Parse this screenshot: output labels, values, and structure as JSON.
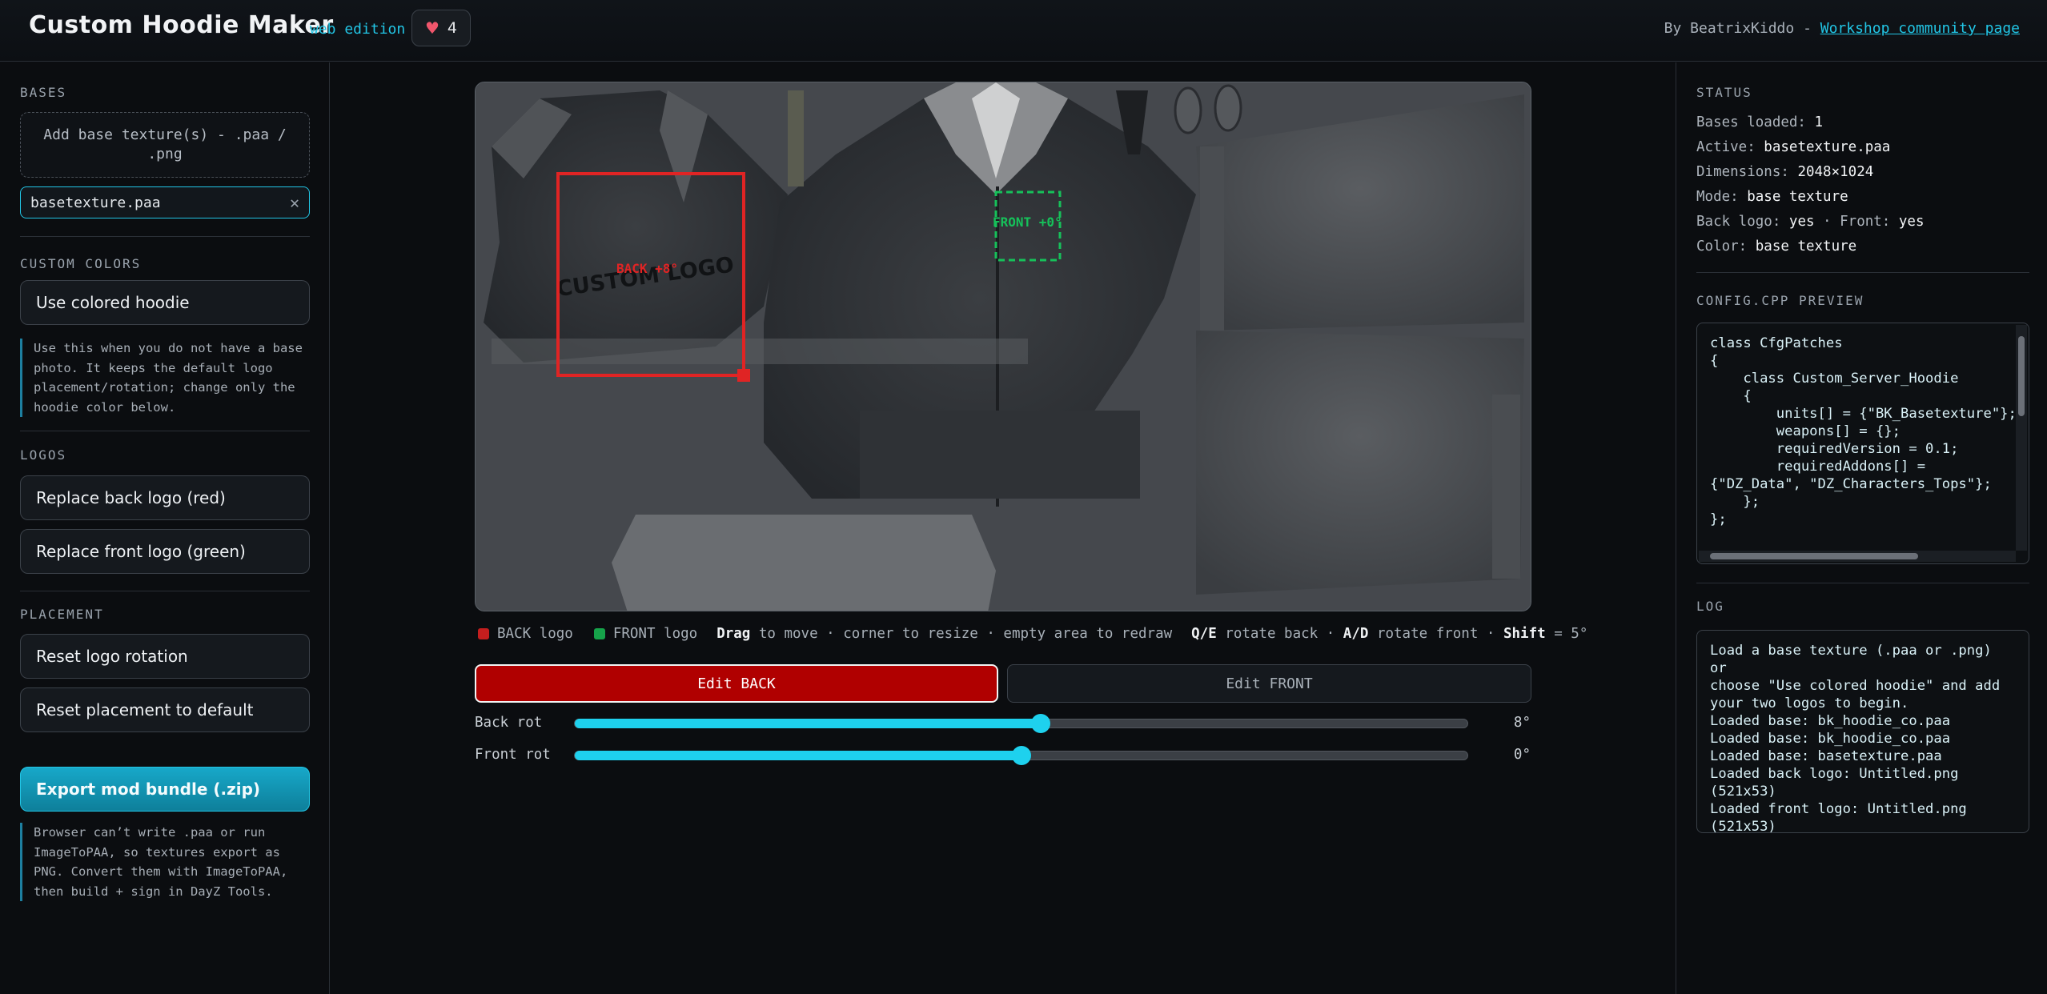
{
  "header": {
    "title": "Custom Hoodie Maker",
    "edition": "web edition",
    "likes": "4",
    "byline_prefix": "By BeatrixKiddo - ",
    "community_link": "Workshop community page"
  },
  "left": {
    "bases_label": "BASES",
    "dropzone_text": "Add base texture(s) - .paa / .png",
    "active_file": "basetexture.paa",
    "custom_colors_label": "CUSTOM COLORS",
    "colored_hoodie_btn": "Use colored hoodie",
    "colored_note": "Use this when you do not have a base photo. It keeps the default logo placement/rotation; change only the hoodie color below.",
    "logos_label": "LOGOS",
    "replace_back_btn": "Replace back logo (red)",
    "replace_front_btn": "Replace front logo (green)",
    "placement_label": "PLACEMENT",
    "reset_rotation_btn": "Reset logo rotation",
    "reset_placement_btn": "Reset placement to default",
    "export_btn": "Export mod bundle (.zip)",
    "export_note": "Browser can’t write .paa or run ImageToPAA, so textures export as PNG. Convert them with ImageToPAA, then build + sign in DayZ Tools."
  },
  "canvas": {
    "back_box_label": "BACK +8°",
    "front_box_label": "FRONT +0°",
    "logo_text": "CUSTOM LOGO"
  },
  "legend": {
    "back": "BACK logo",
    "front": "FRONT logo",
    "drag": "Drag",
    "drag_rest": " to move · corner to resize · empty area to redraw",
    "qe": "Q/E",
    "qe_rest": " rotate back · ",
    "ad": "A/D",
    "ad_rest": " rotate front · ",
    "shift": "Shift",
    "shift_rest": " = 5°"
  },
  "edit": {
    "back_btn": "Edit BACK",
    "front_btn": "Edit FRONT"
  },
  "rotation": {
    "back_label": "Back rot",
    "back_value": "8°",
    "back_fraction": 0.522,
    "front_label": "Front rot",
    "front_value": "0°",
    "front_fraction": 0.5
  },
  "status": {
    "label": "STATUS",
    "bases_loaded_k": "Bases loaded: ",
    "bases_loaded_v": "1",
    "active_k": "Active: ",
    "active_v": "basetexture.paa",
    "dimensions_k": "Dimensions: ",
    "dimensions_v": "2048×1024",
    "mode_k": "Mode: ",
    "mode_v": "base texture",
    "backlogo_k": "Back logo: ",
    "backlogo_v": "yes",
    "front_k": " · Front: ",
    "front_v": "yes",
    "color_k": "Color: ",
    "color_v": "base texture"
  },
  "config": {
    "label": "CONFIG.CPP PREVIEW",
    "code": "class CfgPatches\n{\n    class Custom_Server_Hoodie\n    {\n        units[] = {\"BK_Basetexture\"};\n        weapons[] = {};\n        requiredVersion = 0.1;\n        requiredAddons[] =\n{\"DZ_Data\", \"DZ_Characters_Tops\"};\n    };\n};"
  },
  "log": {
    "label": "LOG",
    "lines": [
      "Load a base texture (.paa or .png) or",
      "choose \"Use colored hoodie\" and add",
      "your two logos to begin.",
      "Loaded base: bk_hoodie_co.paa",
      "Loaded base: bk_hoodie_co.paa",
      "Loaded base: basetexture.paa",
      "Loaded back logo: Untitled.png",
      "(521x53)",
      "Loaded front logo: Untitled.png",
      "(521x53)"
    ]
  },
  "colors": {
    "accent": "#22c6e6",
    "back": "#e02424",
    "front": "#16c15a"
  },
  "icons": {
    "like": "heart-icon",
    "clear": "close-icon"
  }
}
